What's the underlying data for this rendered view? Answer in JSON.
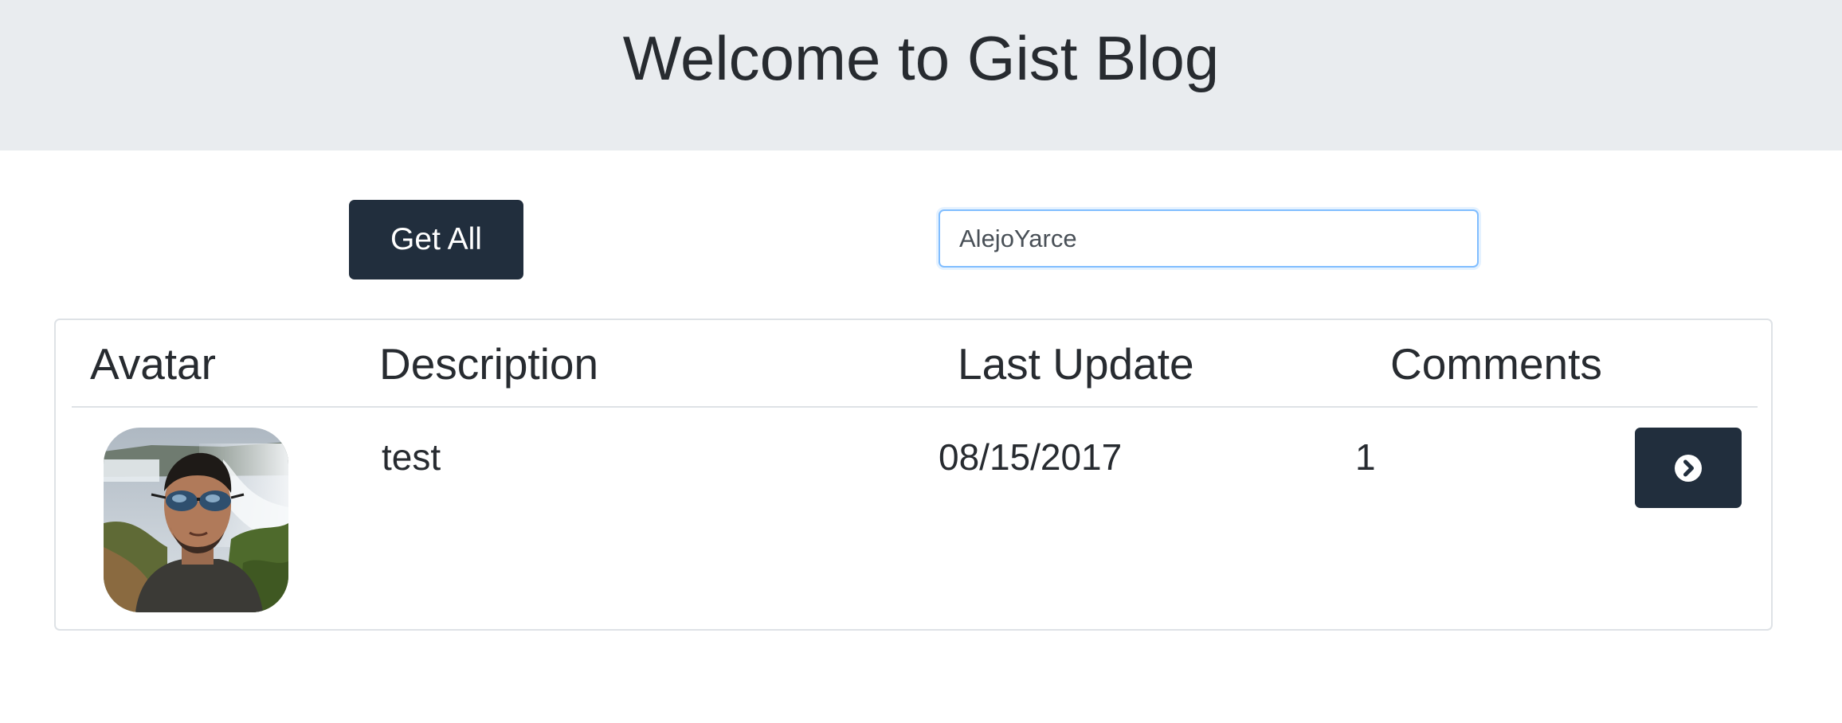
{
  "header": {
    "title": "Welcome to Gist Blog"
  },
  "toolbar": {
    "get_all_label": "Get All",
    "search_value": "AlejoYarce"
  },
  "table": {
    "columns": [
      "Avatar",
      "Description",
      "Last Update",
      "Comments"
    ],
    "rows": [
      {
        "avatar": "user-avatar-photo",
        "description": "test",
        "last_update": "08/15/2017",
        "comments": "1",
        "action_icon": "chevron-right-circle-icon"
      }
    ]
  },
  "colors": {
    "header_bg": "#e9ecef",
    "button_bg": "#212e3d",
    "input_focus_border": "#80bdff",
    "card_border": "#dee2e6",
    "text": "#272b30"
  }
}
